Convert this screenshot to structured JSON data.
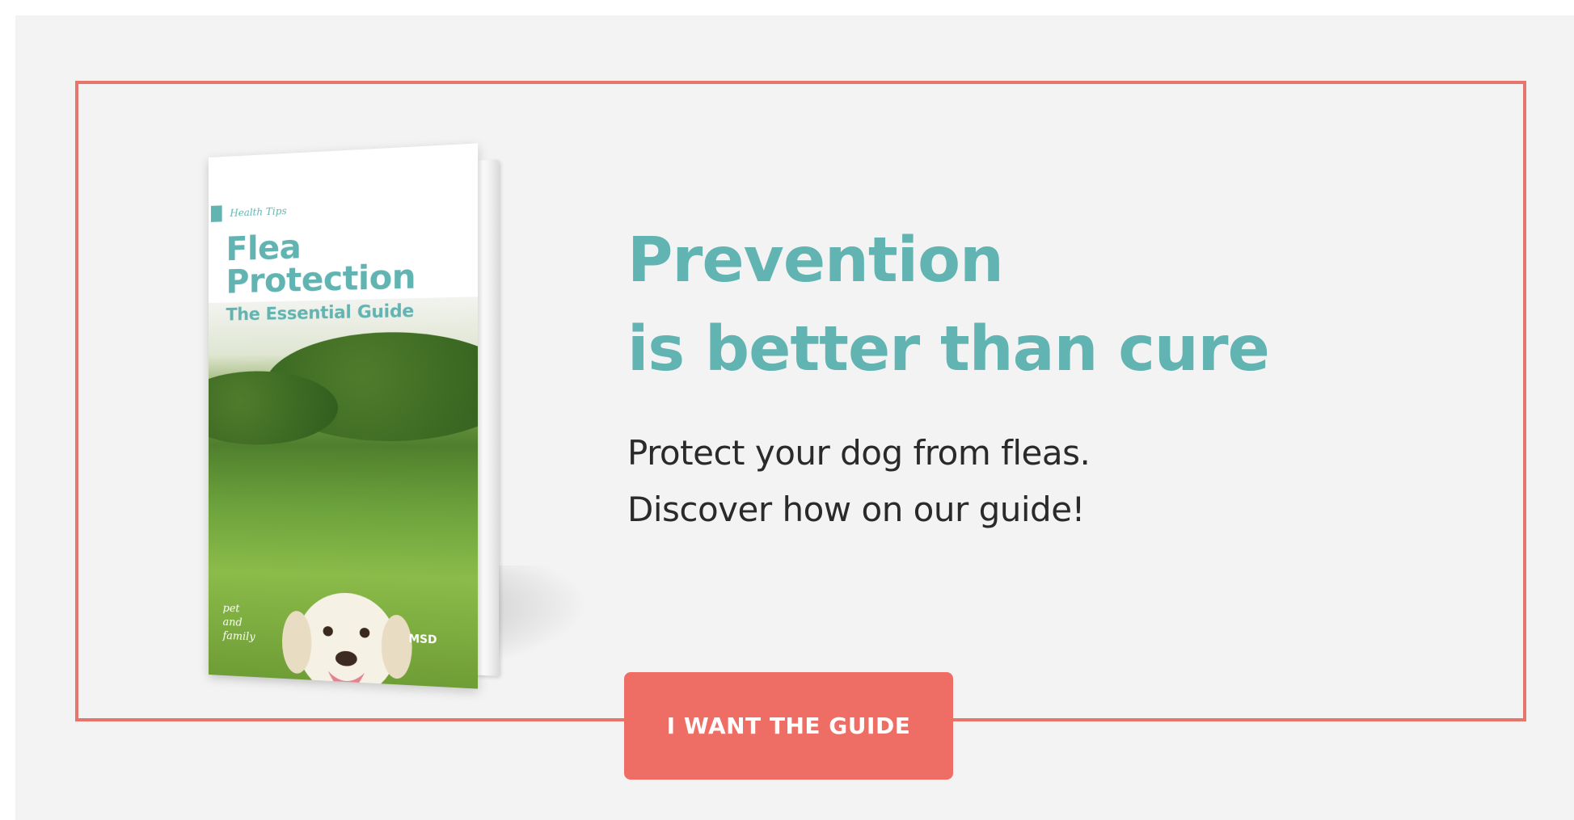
{
  "colors": {
    "accent_teal": "#62b4b2",
    "accent_coral": "#ee6e65",
    "frame_border": "#e6756c",
    "panel_background": "#f3f3f3",
    "body_text": "#2a2a2a"
  },
  "book": {
    "tag": "Health Tips",
    "title_line1": "Flea",
    "title_line2": "Protection",
    "subtitle": "The Essential Guide",
    "brand_line1": "pet",
    "brand_line2": "and",
    "brand_line3": "family",
    "publisher": "MSD",
    "cover_image": "white-labrador-dog-in-grass"
  },
  "headline": {
    "line1": "Prevention",
    "line2": "is better than cure"
  },
  "body": {
    "line1": "Protect your dog from fleas.",
    "line2": "Discover how on our guide!"
  },
  "cta": {
    "label": "I WANT THE GUIDE"
  }
}
